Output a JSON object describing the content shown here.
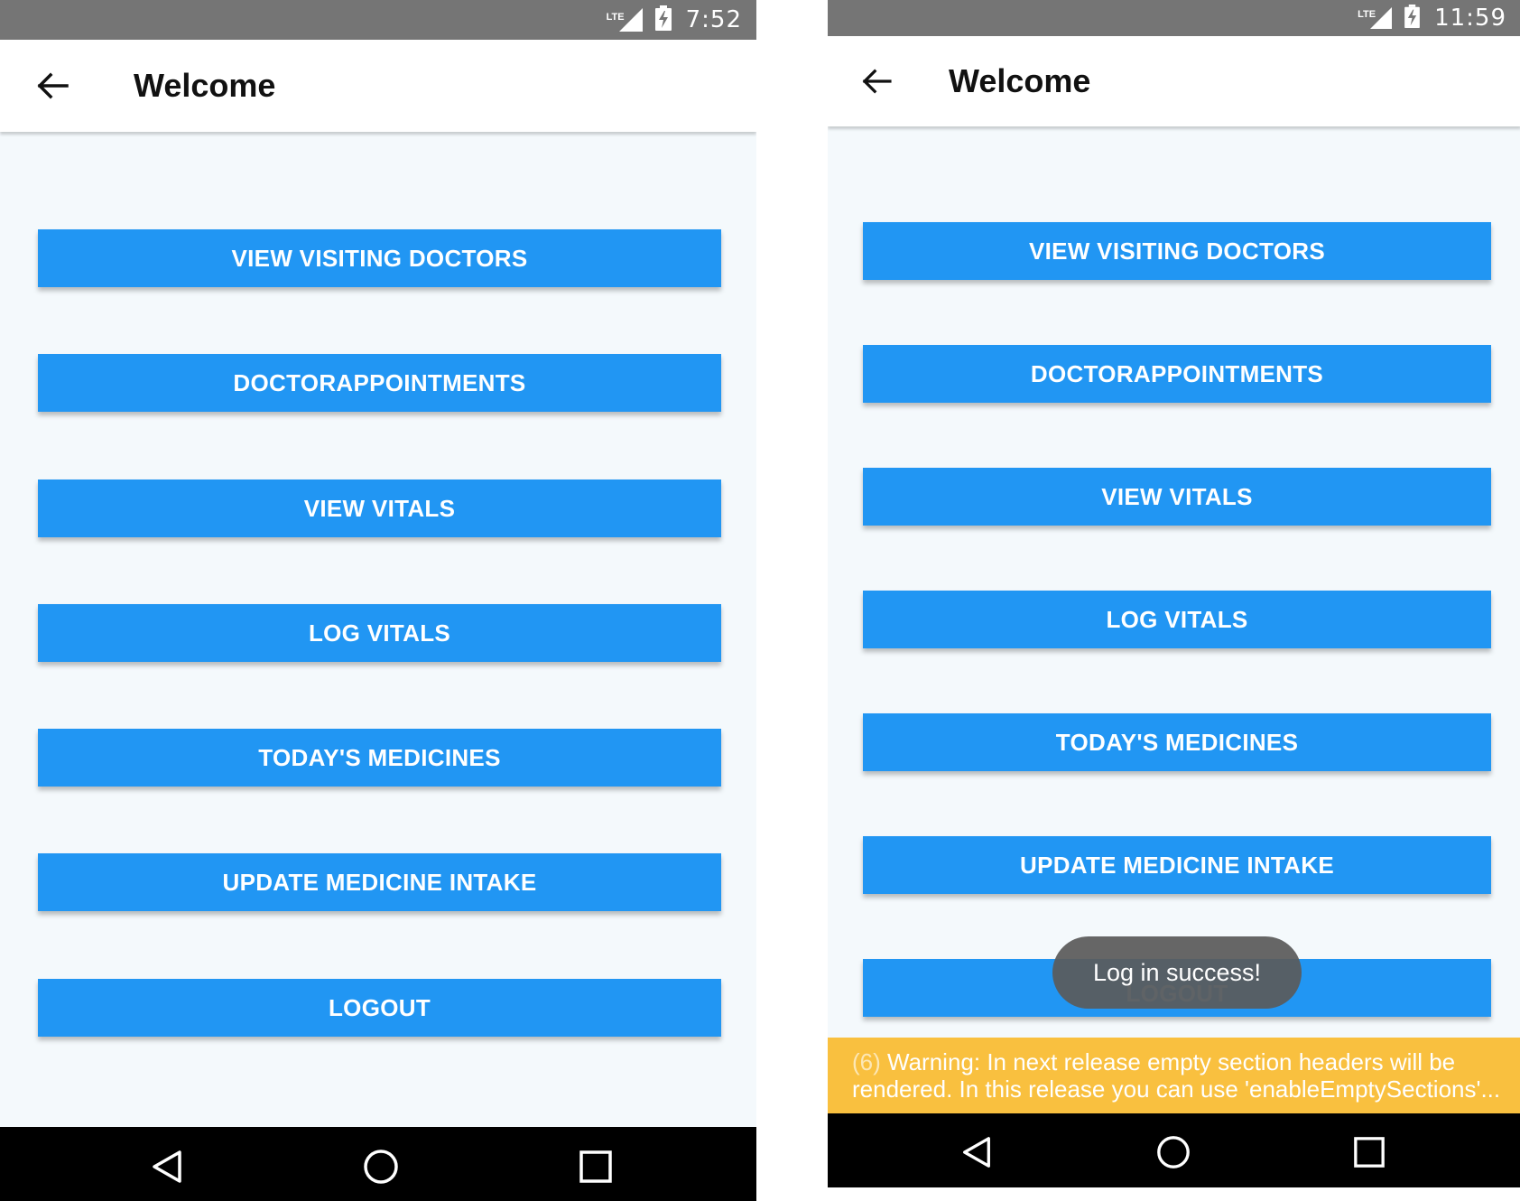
{
  "left_screen": {
    "status": {
      "network": "LTE",
      "time": "7:52"
    },
    "header": {
      "title": "Welcome"
    },
    "buttons": [
      {
        "label": "VIEW VISITING DOCTORS"
      },
      {
        "label": "DOCTORAPPOINTMENTS"
      },
      {
        "label": "VIEW VITALS"
      },
      {
        "label": "LOG VITALS"
      },
      {
        "label": "TODAY'S MEDICINES"
      },
      {
        "label": "UPDATE MEDICINE INTAKE"
      },
      {
        "label": "LOGOUT"
      }
    ]
  },
  "right_screen": {
    "status": {
      "network": "LTE",
      "time": "11:59"
    },
    "header": {
      "title": "Welcome"
    },
    "buttons": [
      {
        "label": "VIEW VISITING DOCTORS"
      },
      {
        "label": "DOCTORAPPOINTMENTS"
      },
      {
        "label": "VIEW VITALS"
      },
      {
        "label": "LOG VITALS"
      },
      {
        "label": "TODAY'S MEDICINES"
      },
      {
        "label": "UPDATE MEDICINE INTAKE"
      },
      {
        "label": "LOGOUT"
      }
    ],
    "toast": "Log in success!",
    "warning": {
      "count": "(6)",
      "line1": "Warning: In next release empty section headers will be",
      "line2": "rendered. In this release you can use 'enableEmptySections'..."
    }
  },
  "colors": {
    "primary": "#2196f3",
    "status_bar": "#757575",
    "background": "#f4f9fc",
    "warning": "#f9c03f",
    "nav_bar": "#000000"
  },
  "icons": [
    "back-arrow-icon",
    "lte-signal-icon",
    "battery-charging-icon",
    "nav-back-icon",
    "nav-home-icon",
    "nav-recents-icon"
  ]
}
